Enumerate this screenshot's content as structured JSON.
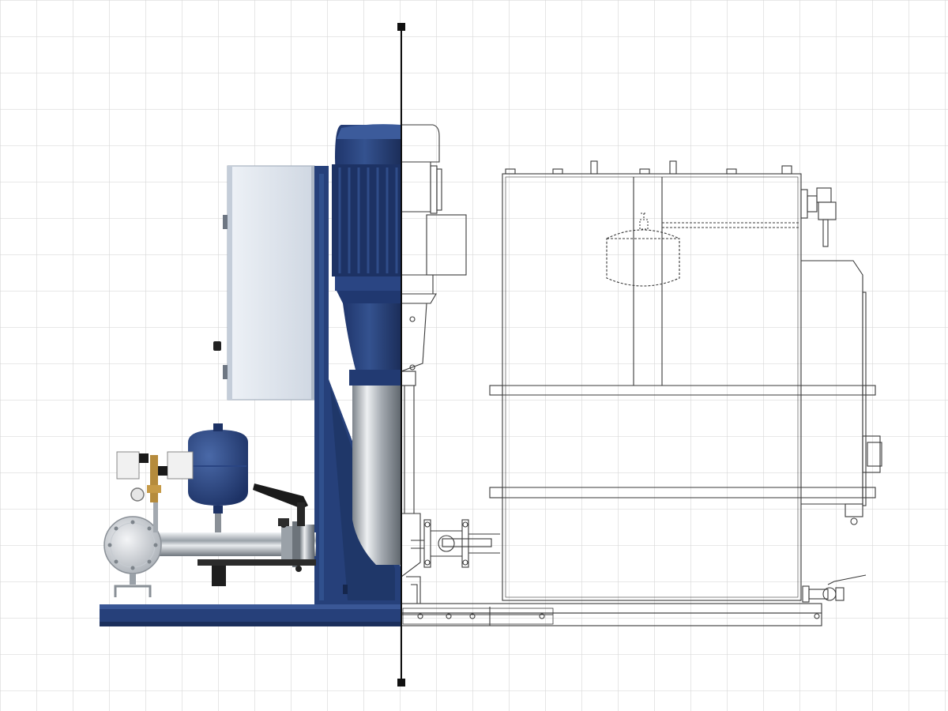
{
  "view": {
    "left_half": "rendered",
    "right_half": "line-drawing",
    "split_handle": "vertical-divider"
  },
  "colors": {
    "background": "#ffffff",
    "grid": "#d9d9d9",
    "frame_blue": "#26407a",
    "frame_blue_dark": "#1b2f5c",
    "panel": "#dde4ee",
    "steel": "#b9bec5",
    "line": "#3a3a3a",
    "handle": "#111111"
  },
  "icons": [
    "split-handle-top-icon",
    "split-handle-bottom-icon"
  ]
}
